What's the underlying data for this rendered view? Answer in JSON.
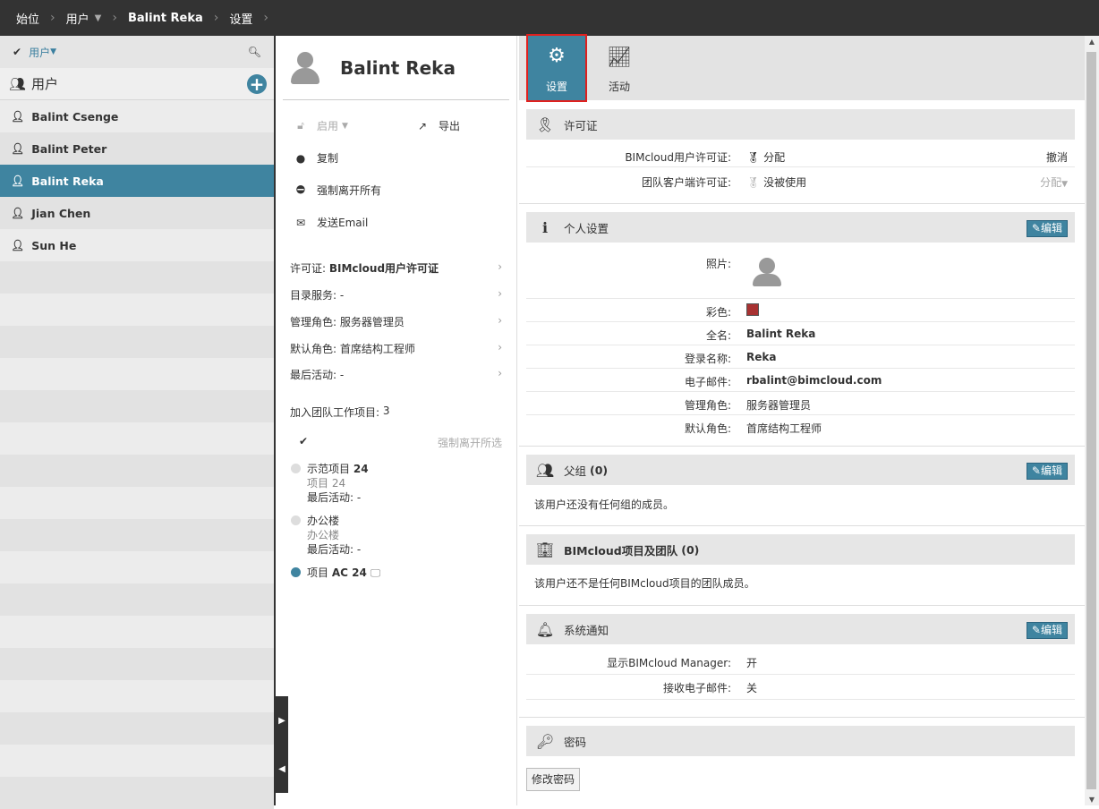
{
  "breadcrumb": [
    "始位",
    "用户",
    "Balint Reka",
    "设置"
  ],
  "left": {
    "filter_label": "用户",
    "group_label": "用户",
    "users": [
      "Balint Csenge",
      "Balint Peter",
      "Balint Reka",
      "Jian Chen",
      "Sun He"
    ],
    "selected": "Balint Reka"
  },
  "mid": {
    "name": "Balint Reka",
    "actions": {
      "enable": "启用",
      "export": "导出",
      "copy": "复制",
      "force_leave_all": "强制离开所有",
      "send_email": "发送Email"
    },
    "info": [
      {
        "label": "许可证:",
        "value": "BIMcloud用户许可证"
      },
      {
        "label": "目录服务:",
        "value": "-"
      },
      {
        "label": "管理角色:",
        "value": "服务器管理员"
      },
      {
        "label": "默认角色:",
        "value": "首席结构工程师"
      },
      {
        "label": "最后活动:",
        "value": "-"
      }
    ],
    "joined_label": "加入团队工作项目:",
    "joined_count": "3",
    "force_leave_selected": "强制离开所选",
    "projects": [
      {
        "name": "示范项目",
        "num": "24",
        "sub": "项目 24",
        "last": "最后活动: -"
      },
      {
        "name": "办公楼",
        "num": "",
        "sub": "办公楼",
        "last": "最后活动: -"
      },
      {
        "name": "项目",
        "num": "AC 24",
        "sub": "",
        "last": ""
      }
    ]
  },
  "tabs": {
    "settings": "设置",
    "activity": "活动"
  },
  "license": {
    "title": "许可证",
    "rows": [
      {
        "k": "BIMcloud用户许可证:",
        "v": "分配",
        "a": "撤消"
      },
      {
        "k": "团队客户端许可证:",
        "v": "没被使用",
        "a": "分配"
      }
    ]
  },
  "personal": {
    "title": "个人设置",
    "edit": "编辑",
    "rows": [
      {
        "k": "照片:"
      },
      {
        "k": "彩色:",
        "color": "#a83232"
      },
      {
        "k": "全名:",
        "v": "Balint Reka"
      },
      {
        "k": "登录名称:",
        "v": "Reka"
      },
      {
        "k": "电子邮件:",
        "v": "rbalint@bimcloud.com"
      },
      {
        "k": "管理角色:",
        "v": "服务器管理员"
      },
      {
        "k": "默认角色:",
        "v": "首席结构工程师"
      }
    ]
  },
  "parent": {
    "title": "父组",
    "count": "(0)",
    "edit": "编辑",
    "empty": "该用户还没有任何组的成员。"
  },
  "projects_teams": {
    "title": "BIMcloud项目及团队",
    "count": "(0)",
    "empty": "该用户还不是任何BIMcloud项目的团队成员。"
  },
  "notify": {
    "title": "系统通知",
    "edit": "编辑",
    "rows": [
      {
        "k": "显示BIMcloud Manager:",
        "v": "开"
      },
      {
        "k": "接收电子邮件:",
        "v": "关"
      }
    ]
  },
  "password": {
    "title": "密码",
    "button": "修改密码"
  }
}
